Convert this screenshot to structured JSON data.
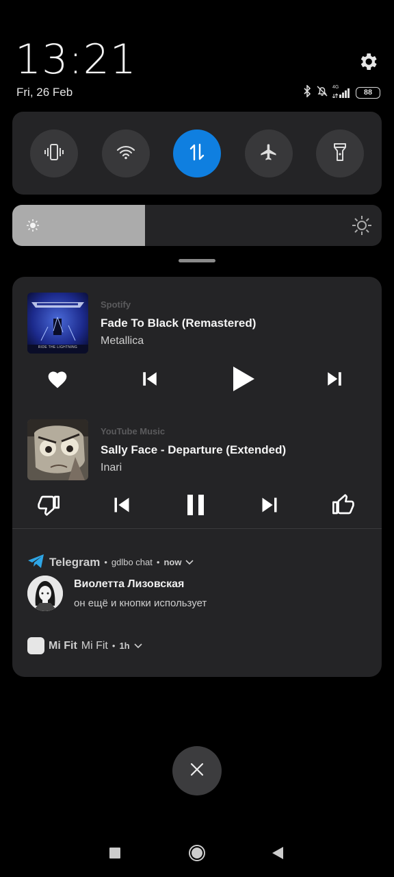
{
  "status": {
    "time": "13:21",
    "date": "Fri, 26 Feb",
    "network": "4G",
    "battery": "88"
  },
  "quick_settings": [
    {
      "name": "vibrate",
      "icon": "vibrate-icon",
      "active": false
    },
    {
      "name": "wifi",
      "icon": "wifi-icon",
      "active": false
    },
    {
      "name": "mobile-data",
      "icon": "data-transfer-icon",
      "active": true
    },
    {
      "name": "airplane-mode",
      "icon": "airplane-icon",
      "active": false
    },
    {
      "name": "flashlight",
      "icon": "flashlight-icon",
      "active": false
    }
  ],
  "brightness": {
    "level": 0.36
  },
  "media": [
    {
      "app": "Spotify",
      "title": "Fade To Black (Remastered)",
      "artist": "Metallica",
      "album_art_text": "RIDE THE LIGHTNING",
      "controls": [
        "heart-icon",
        "previous-icon",
        "play-icon",
        "next-icon"
      ]
    },
    {
      "app": "YouTube Music",
      "title": "Sally Face - Departure (Extended)",
      "artist": "Inari",
      "controls": [
        "thumbs-down-icon",
        "previous-icon",
        "pause-icon",
        "next-icon",
        "thumbs-up-icon"
      ]
    }
  ],
  "notifications": {
    "telegram": {
      "app": "Telegram",
      "chat": "gdlbo chat",
      "time": "now",
      "sender": "Виолетта Лизовская",
      "message": "он ещё и кнопки использует"
    },
    "mifit": {
      "app": "Mi Fit",
      "title": "Mi Fit",
      "time": "1h"
    }
  },
  "colors": {
    "accent": "#0f7fe0",
    "panel": "#242426",
    "background": "#000000"
  }
}
